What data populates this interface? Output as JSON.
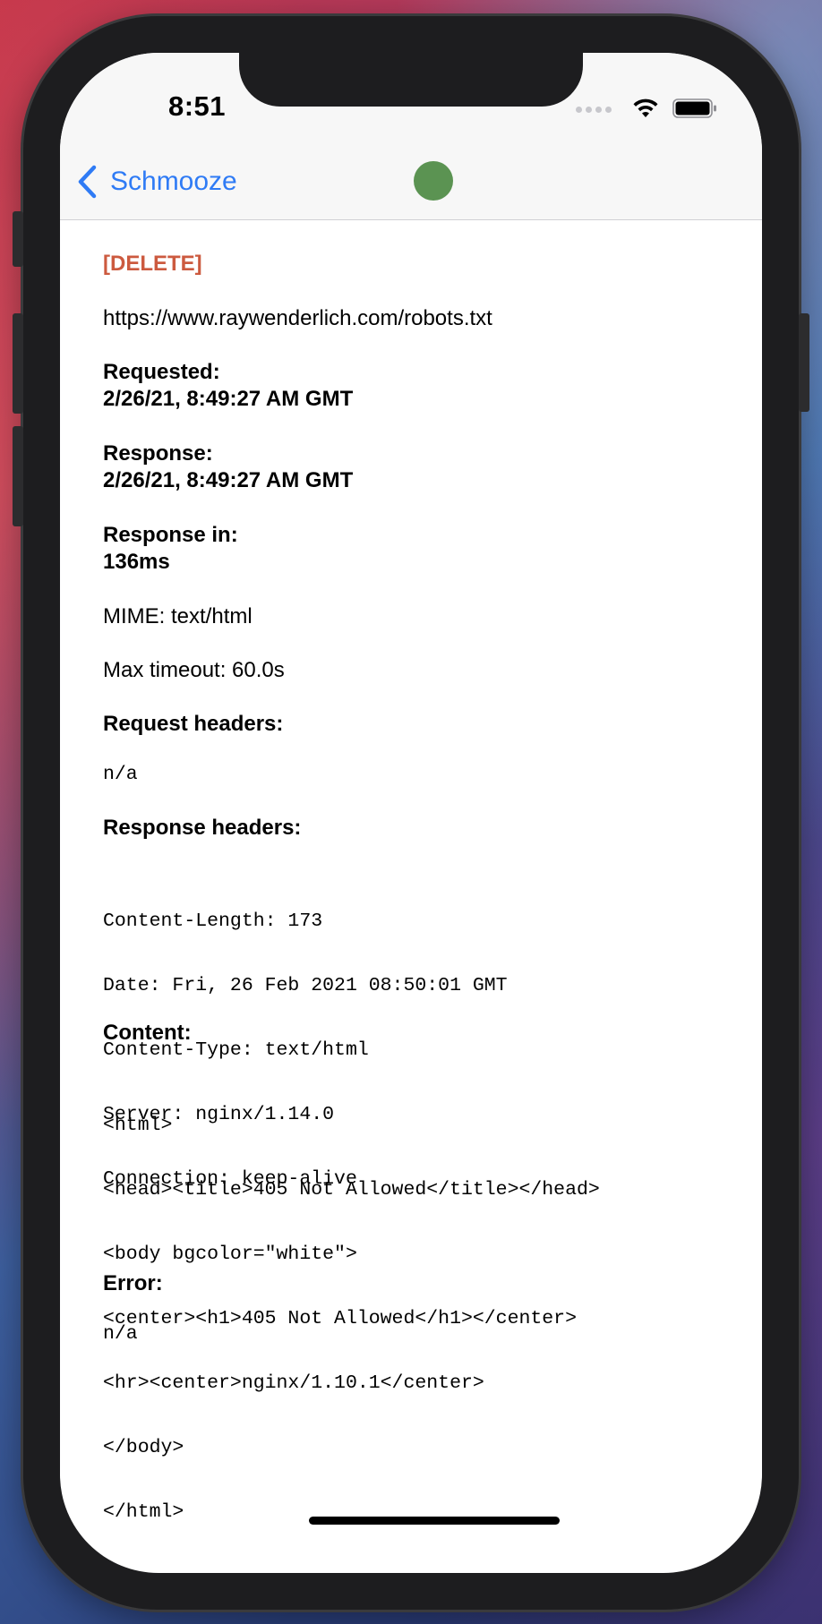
{
  "status_bar": {
    "time": "8:51"
  },
  "nav": {
    "back_label": "Schmooze",
    "status_color": "#5b9352"
  },
  "request": {
    "method": "[DELETE]",
    "url": "https://www.raywenderlich.com/robots.txt",
    "requested_label": "Requested:",
    "requested_value": "2/26/21, 8:49:27 AM GMT",
    "response_label": "Response:",
    "response_value": "2/26/21, 8:49:27 AM GMT",
    "response_in_label": "Response in:",
    "response_in_value": "136ms",
    "mime": "MIME: text/html",
    "max_timeout": "Max timeout: 60.0s",
    "request_headers_label": "Request headers:",
    "request_headers_value": "n/a",
    "response_headers_label": "Response headers:",
    "response_headers_lines": [
      "Content-Length: 173",
      "Date: Fri, 26 Feb 2021 08:50:01 GMT",
      "Content-Type: text/html",
      "Server: nginx/1.14.0",
      "Connection: keep-alive"
    ],
    "content_label": "Content:",
    "content_lines": [
      "<html>",
      "<head><title>405 Not Allowed</title></head>",
      "<body bgcolor=\"white\">",
      "<center><h1>405 Not Allowed</h1></center>",
      "<hr><center>nginx/1.10.1</center>",
      "</body>",
      "</html>"
    ],
    "error_label": "Error:",
    "error_value": "n/a"
  },
  "colors": {
    "accent": "#2f7bf5",
    "method": "#cc5a3f"
  }
}
